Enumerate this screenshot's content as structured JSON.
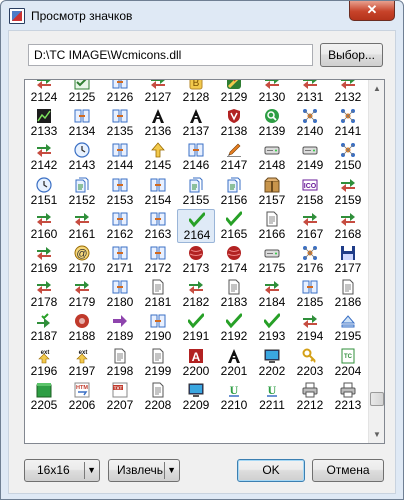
{
  "window": {
    "title": "Просмотр значков"
  },
  "path": {
    "value": "D:\\TC IMAGE\\Wcmicons.dll"
  },
  "buttons": {
    "browse": "Выбор...",
    "size": "16x16",
    "extract": "Извлечь",
    "ok": "OK",
    "cancel": "Отмена"
  },
  "selected_icon": "2164",
  "icons": [
    {
      "label": "2124",
      "icon": "transfer-icon"
    },
    {
      "label": "2125",
      "icon": "check-sync-icon"
    },
    {
      "label": "2126",
      "icon": "compare-icon"
    },
    {
      "label": "2127",
      "icon": "transfer-icon"
    },
    {
      "label": "2128",
      "icon": "b-document-icon"
    },
    {
      "label": "2129",
      "icon": "zip-icon"
    },
    {
      "label": "2130",
      "icon": "transfer-icon"
    },
    {
      "label": "2131",
      "icon": "transfer-icon"
    },
    {
      "label": "2132",
      "icon": "transfer-icon"
    },
    {
      "label": "2133",
      "icon": "chart-icon"
    },
    {
      "label": "2134",
      "icon": "compare-icon"
    },
    {
      "label": "2135",
      "icon": "compare-icon"
    },
    {
      "label": "2136",
      "icon": "font-a-icon"
    },
    {
      "label": "2137",
      "icon": "font-a-icon"
    },
    {
      "label": "2138",
      "icon": "shield-icon"
    },
    {
      "label": "2139",
      "icon": "search-globe-icon"
    },
    {
      "label": "2140",
      "icon": "network-icon"
    },
    {
      "label": "2141",
      "icon": "network-icon"
    },
    {
      "label": "2142",
      "icon": "transfer-icon"
    },
    {
      "label": "2143",
      "icon": "clock-icon"
    },
    {
      "label": "2144",
      "icon": "compare-icon"
    },
    {
      "label": "2145",
      "icon": "arrow-up-icon"
    },
    {
      "label": "2146",
      "icon": "compare-icon"
    },
    {
      "label": "2147",
      "icon": "pencil-icon"
    },
    {
      "label": "2148",
      "icon": "drive-icon"
    },
    {
      "label": "2149",
      "icon": "drive-icon"
    },
    {
      "label": "2150",
      "icon": "network-icon"
    },
    {
      "label": "2151",
      "icon": "clock-icon"
    },
    {
      "label": "2152",
      "icon": "documents-icon"
    },
    {
      "label": "2153",
      "icon": "compare-icon"
    },
    {
      "label": "2154",
      "icon": "compare-icon"
    },
    {
      "label": "2155",
      "icon": "documents-icon"
    },
    {
      "label": "2156",
      "icon": "documents-icon"
    },
    {
      "label": "2157",
      "icon": "package-icon"
    },
    {
      "label": "2158",
      "icon": "ico-icon"
    },
    {
      "label": "2159",
      "icon": "transfer-icon"
    },
    {
      "label": "2160",
      "icon": "transfer-icon"
    },
    {
      "label": "2161",
      "icon": "transfer-icon"
    },
    {
      "label": "2162",
      "icon": "compare-icon"
    },
    {
      "label": "2163",
      "icon": "compare-icon"
    },
    {
      "label": "2164",
      "icon": "checkmark-icon"
    },
    {
      "label": "2165",
      "icon": "checkmark-icon"
    },
    {
      "label": "2166",
      "icon": "document-icon"
    },
    {
      "label": "2167",
      "icon": "transfer-icon"
    },
    {
      "label": "2168",
      "icon": "transfer-icon"
    },
    {
      "label": "2169",
      "icon": "transfer-icon"
    },
    {
      "label": "2170",
      "icon": "email-icon"
    },
    {
      "label": "2171",
      "icon": "compare-icon"
    },
    {
      "label": "2172",
      "icon": "compare-icon"
    },
    {
      "label": "2173",
      "icon": "ball-icon"
    },
    {
      "label": "2174",
      "icon": "ball-icon"
    },
    {
      "label": "2175",
      "icon": "drive-icon"
    },
    {
      "label": "2176",
      "icon": "network-icon"
    },
    {
      "label": "2177",
      "icon": "floppy-icon"
    },
    {
      "label": "2178",
      "icon": "transfer-icon"
    },
    {
      "label": "2179",
      "icon": "transfer-icon"
    },
    {
      "label": "2180",
      "icon": "compare-icon"
    },
    {
      "label": "2181",
      "icon": "document-icon"
    },
    {
      "label": "2182",
      "icon": "transfer-icon"
    },
    {
      "label": "2183",
      "icon": "document-icon"
    },
    {
      "label": "2184",
      "icon": "transfer-icon"
    },
    {
      "label": "2185",
      "icon": "compare-icon"
    },
    {
      "label": "2186",
      "icon": "document-icon"
    },
    {
      "label": "2187",
      "icon": "arrow-check-icon"
    },
    {
      "label": "2188",
      "icon": "record-icon"
    },
    {
      "label": "2189",
      "icon": "arrow-right-icon"
    },
    {
      "label": "2190",
      "icon": "compare-icon"
    },
    {
      "label": "2191",
      "icon": "checkmark-icon"
    },
    {
      "label": "2192",
      "icon": "checkmark-icon"
    },
    {
      "label": "2193",
      "icon": "checkmark-icon"
    },
    {
      "label": "2194",
      "icon": "transfer-icon"
    },
    {
      "label": "2195",
      "icon": "eject-icon"
    },
    {
      "label": "2196",
      "icon": "ext-arrow-icon"
    },
    {
      "label": "2197",
      "icon": "ext-arrow-icon"
    },
    {
      "label": "2198",
      "icon": "document-icon"
    },
    {
      "label": "2199",
      "icon": "document-icon"
    },
    {
      "label": "2200",
      "icon": "a-red-icon"
    },
    {
      "label": "2201",
      "icon": "font-a-icon"
    },
    {
      "label": "2202",
      "icon": "monitor-icon"
    },
    {
      "label": "2203",
      "icon": "key-icon"
    },
    {
      "label": "2204",
      "icon": "tc-icon"
    },
    {
      "label": "2205",
      "icon": "green-box-icon"
    },
    {
      "label": "2206",
      "icon": "htm-icon"
    },
    {
      "label": "2207",
      "icon": "txt-icon"
    },
    {
      "label": "2208",
      "icon": "document-icon"
    },
    {
      "label": "2209",
      "icon": "monitor-icon"
    },
    {
      "label": "2210",
      "icon": "unicode-icon"
    },
    {
      "label": "2211",
      "icon": "unicode-icon"
    },
    {
      "label": "2212",
      "icon": "printer-icon"
    },
    {
      "label": "2213",
      "icon": "printer-icon"
    }
  ]
}
